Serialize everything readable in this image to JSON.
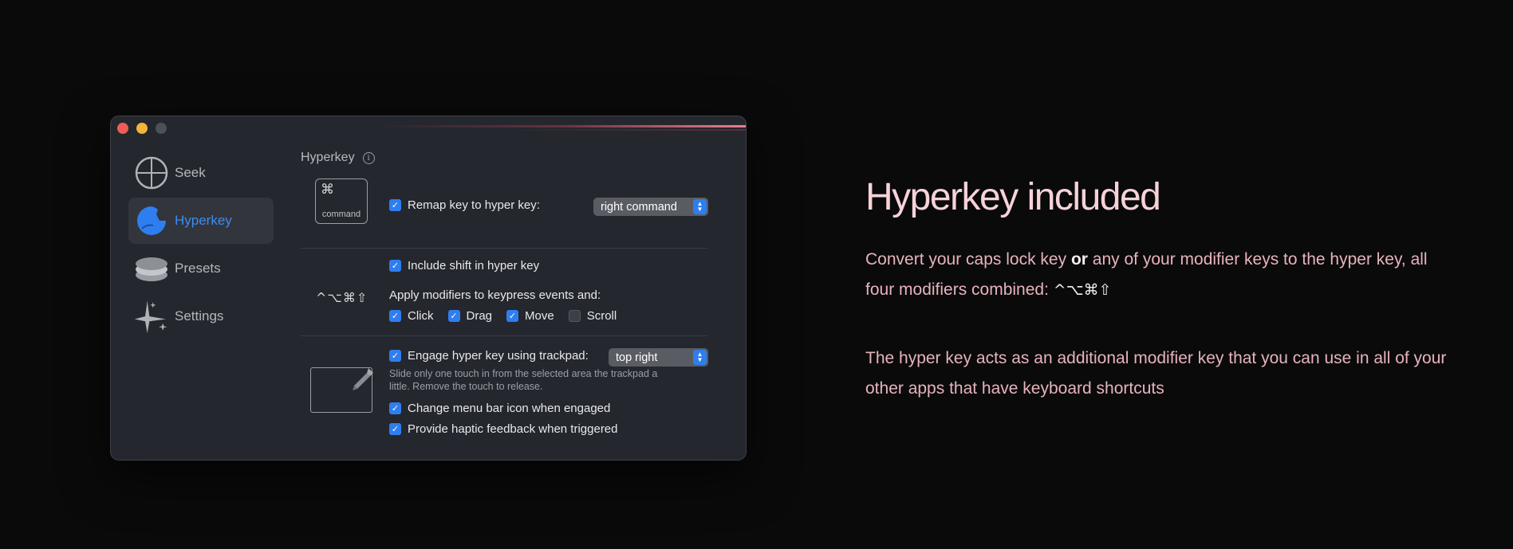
{
  "window": {
    "sidebar": {
      "items": [
        {
          "label": "Seek",
          "icon": "crosshair-icon",
          "active": false
        },
        {
          "label": "Hyperkey",
          "icon": "hyperkey-icon",
          "active": true
        },
        {
          "label": "Presets",
          "icon": "stack-icon",
          "active": false
        },
        {
          "label": "Settings",
          "icon": "sparkle-icon",
          "active": false
        }
      ]
    },
    "section_title": "Hyperkey",
    "info_glyph": "i",
    "keycap": {
      "glyph": "⌘",
      "label": "command"
    },
    "remap": {
      "label": "Remap key to hyper key:",
      "checked": true,
      "popup_value": "right command"
    },
    "modifier_symbols": "^⌥⌘⇧",
    "include_shift": {
      "label": "Include shift in hyper key",
      "checked": true
    },
    "apply_label": "Apply modifiers to keypress events and:",
    "events": [
      {
        "label": "Click",
        "checked": true
      },
      {
        "label": "Drag",
        "checked": true
      },
      {
        "label": "Move",
        "checked": true
      },
      {
        "label": "Scroll",
        "checked": false
      }
    ],
    "trackpad": {
      "label": "Engage hyper key using trackpad:",
      "checked": true,
      "popup_value": "top right"
    },
    "trackpad_hint_line1": "Slide only one touch in from the selected area the trackpad a",
    "trackpad_hint_line2": "little. Remove the touch to release.",
    "menu_icon": {
      "label": "Change menu bar icon when engaged",
      "checked": true
    },
    "haptic": {
      "label": "Provide haptic feedback when triggered",
      "checked": true
    }
  },
  "marketing": {
    "headline": "Hyperkey included",
    "p1_a": "Convert your caps lock key",
    "p1_or": "or",
    "p1_b": "any of your modifier keys to the hyper key, all",
    "p1_c": "four modifiers combined:",
    "p1_mods": "^⌥⌘⇧",
    "p2_line1": "The hyper key acts as an additional modifier key that you can use in all of your",
    "p2_line2": "other apps that have keyboard shortcuts"
  },
  "colors": {
    "accent_blue": "#2f7ef0",
    "headline_pink": "#f6d3d8",
    "body_pink": "#e7b3bc",
    "window_bg": "#25272e"
  }
}
